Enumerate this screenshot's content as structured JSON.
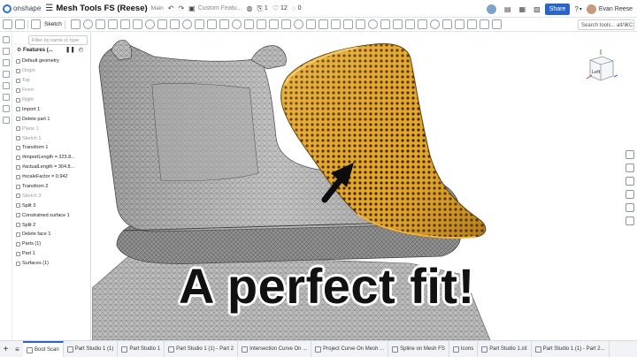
{
  "header": {
    "logo_text": "onshape",
    "document_title": "Mesh Tools FS (Reese)",
    "workspace": "Main",
    "custom_feature_field": "Custom Featu...",
    "versions_count": "1",
    "likes_count": "12",
    "comments_count": "0",
    "share_label": "Share",
    "user_name": "Evan Reese"
  },
  "toolbar": {
    "sketch_label": "Sketch",
    "search_tools": "Search tools... alt/⌘C"
  },
  "feature_panel": {
    "filter_placeholder": "Filter by name or type",
    "features_label": "Features (...",
    "items": [
      {
        "label": "Default geometry",
        "state": "normal"
      },
      {
        "label": "Origin",
        "state": "dim"
      },
      {
        "label": "Top",
        "state": "dim"
      },
      {
        "label": "Front",
        "state": "dim"
      },
      {
        "label": "Right",
        "state": "dim"
      },
      {
        "label": "Import 1",
        "state": "normal"
      },
      {
        "label": "Delete part 1",
        "state": "normal"
      },
      {
        "label": "Plane 1",
        "state": "dim"
      },
      {
        "label": "Sketch 1",
        "state": "dim"
      },
      {
        "label": "Transform 1",
        "state": "normal"
      },
      {
        "label": "#importLength = 323.8...",
        "state": "normal"
      },
      {
        "label": "#actualLength = 304.8...",
        "state": "normal"
      },
      {
        "label": "#scaleFactor = 0.942",
        "state": "normal"
      },
      {
        "label": "Transform 2",
        "state": "normal"
      },
      {
        "label": "Sketch 3",
        "state": "dim"
      },
      {
        "label": "Split 3",
        "state": "normal"
      },
      {
        "label": "Constrained surface 1",
        "state": "normal"
      },
      {
        "label": "Split 2",
        "state": "normal"
      },
      {
        "label": "Delete face 1",
        "state": "normal"
      },
      {
        "label": "Parts (1)",
        "state": "normal"
      },
      {
        "label": "Part 1",
        "state": "normal"
      },
      {
        "label": "Surfaces (1)",
        "state": "normal"
      }
    ]
  },
  "viewport": {
    "headline": "A perfect fit!",
    "viewcube_face": "Left",
    "colors": {
      "mesh_gray": "#b8b8b8",
      "last_gold": "#e0a12a",
      "last_dark": "#8a5a0c"
    }
  },
  "bottom_tabs": [
    {
      "label": "Boot Scan",
      "active": true
    },
    {
      "label": "Part Studio 1 (1)",
      "active": false
    },
    {
      "label": "Part Studio 1",
      "active": false
    },
    {
      "label": "Part Studio 1 (1) - Part 2",
      "active": false
    },
    {
      "label": "Intersection Curve On ...",
      "active": false
    },
    {
      "label": "Project Curve On Mesh ...",
      "active": false
    },
    {
      "label": "Spline on Mesh FS",
      "active": false
    },
    {
      "label": "Icons",
      "active": false
    },
    {
      "label": "Part Studio 1.stl",
      "active": false
    },
    {
      "label": "Part Studio 1 (1) - Part 2...",
      "active": false
    }
  ]
}
